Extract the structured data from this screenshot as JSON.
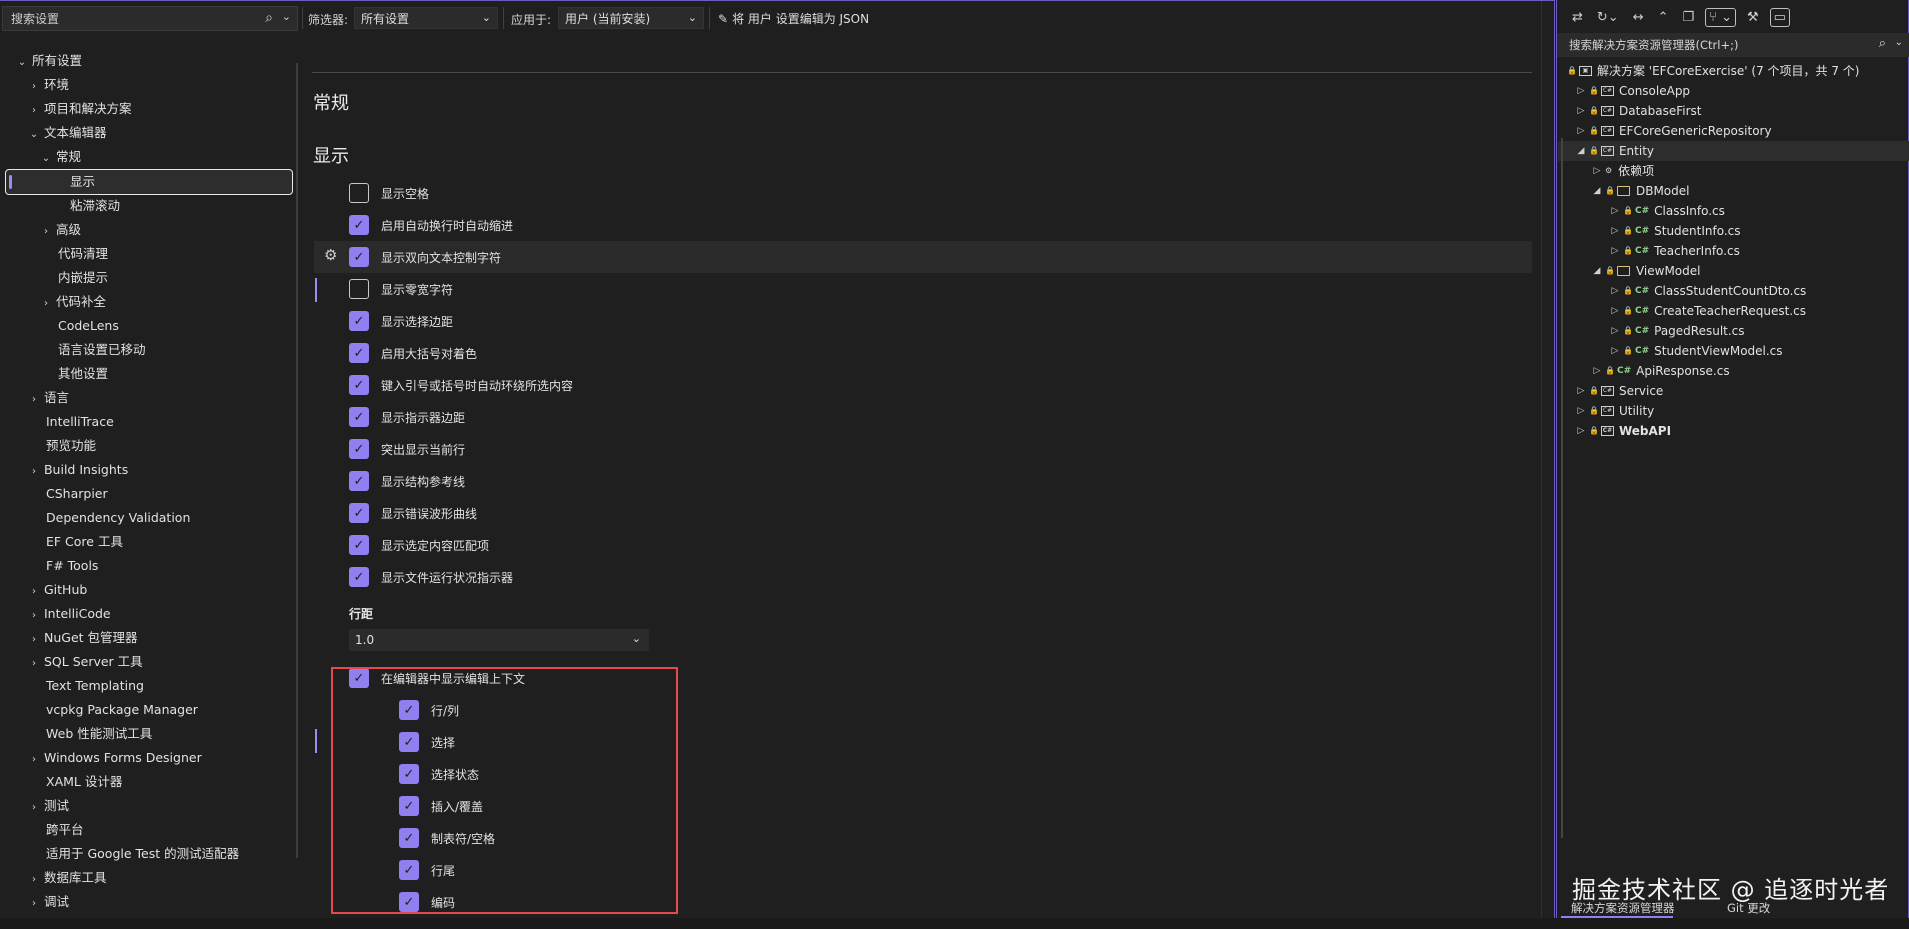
{
  "topbar": {
    "search_placeholder": "搜索设置",
    "filter_label": "筛选器:",
    "filter_value": "所有设置",
    "apply_label": "应用于:",
    "apply_value": "用户 (当前安装)",
    "json_button": "将 用户 设置编辑为 JSON"
  },
  "tree": {
    "items": [
      {
        "label": "所有设置"
      },
      {
        "label": "环境"
      },
      {
        "label": "项目和解决方案"
      },
      {
        "label": "文本编辑器"
      },
      {
        "label": "常规"
      },
      {
        "label": "显示"
      },
      {
        "label": "粘滞滚动"
      },
      {
        "label": "高级"
      },
      {
        "label": "代码清理"
      },
      {
        "label": "内嵌提示"
      },
      {
        "label": "代码补全"
      },
      {
        "label": "CodeLens"
      },
      {
        "label": "语言设置已移动"
      },
      {
        "label": "其他设置"
      },
      {
        "label": "语言"
      },
      {
        "label": "IntelliTrace"
      },
      {
        "label": "预览功能"
      },
      {
        "label": "Build Insights"
      },
      {
        "label": "CSharpier"
      },
      {
        "label": "Dependency Validation"
      },
      {
        "label": "EF Core 工具"
      },
      {
        "label": "F# Tools"
      },
      {
        "label": "GitHub"
      },
      {
        "label": "IntelliCode"
      },
      {
        "label": "NuGet 包管理器"
      },
      {
        "label": "SQL Server 工具"
      },
      {
        "label": "Text Templating"
      },
      {
        "label": "vcpkg Package Manager"
      },
      {
        "label": "Web 性能测试工具"
      },
      {
        "label": "Windows Forms Designer"
      },
      {
        "label": "XAML 设计器"
      },
      {
        "label": "测试"
      },
      {
        "label": "跨平台"
      },
      {
        "label": "适用于 Google Test 的测试适配器"
      },
      {
        "label": "数据库工具"
      },
      {
        "label": "调试"
      }
    ]
  },
  "content": {
    "section_title": "常规",
    "subsection_title": "显示",
    "options": [
      {
        "label": "显示空格",
        "checked": false
      },
      {
        "label": "启用自动换行时自动缩进",
        "checked": true
      },
      {
        "label": "显示双向文本控制字符",
        "checked": true
      },
      {
        "label": "显示零宽字符",
        "checked": false
      },
      {
        "label": "显示选择边距",
        "checked": true
      },
      {
        "label": "启用大括号对着色",
        "checked": true
      },
      {
        "label": "键入引号或括号时自动环绕所选内容",
        "checked": true
      },
      {
        "label": "显示指示器边距",
        "checked": true
      },
      {
        "label": "突出显示当前行",
        "checked": true
      },
      {
        "label": "显示结构参考线",
        "checked": true
      },
      {
        "label": "显示错误波形曲线",
        "checked": true
      },
      {
        "label": "显示选定内容匹配项",
        "checked": true
      },
      {
        "label": "显示文件运行状况指示器",
        "checked": true
      }
    ],
    "line_spacing_label": "行距",
    "line_spacing_value": "1.0",
    "context_option": {
      "label": "在编辑器中显示编辑上下文",
      "checked": true
    },
    "context_suboptions": [
      {
        "label": "行/列",
        "checked": true
      },
      {
        "label": "选择",
        "checked": true
      },
      {
        "label": "选择状态",
        "checked": true
      },
      {
        "label": "插入/覆盖",
        "checked": true
      },
      {
        "label": "制表符/空格",
        "checked": true
      },
      {
        "label": "行尾",
        "checked": true
      },
      {
        "label": "编码",
        "checked": true
      }
    ]
  },
  "solution_explorer": {
    "search_placeholder": "搜索解决方案资源管理器(Ctrl+;)",
    "nodes": [
      {
        "label": "解决方案 'EFCoreExercise' (7 个项目，共 7 个)"
      },
      {
        "label": "ConsoleApp"
      },
      {
        "label": "DatabaseFirst"
      },
      {
        "label": "EFCoreGenericRepository"
      },
      {
        "label": "Entity"
      },
      {
        "label": "依赖项"
      },
      {
        "label": "DBModel"
      },
      {
        "label": "ClassInfo.cs"
      },
      {
        "label": "StudentInfo.cs"
      },
      {
        "label": "TeacherInfo.cs"
      },
      {
        "label": "ViewModel"
      },
      {
        "label": "ClassStudentCountDto.cs"
      },
      {
        "label": "CreateTeacherRequest.cs"
      },
      {
        "label": "PagedResult.cs"
      },
      {
        "label": "StudentViewModel.cs"
      },
      {
        "label": "ApiResponse.cs"
      },
      {
        "label": "Service"
      },
      {
        "label": "Utility"
      },
      {
        "label": "WebAPI"
      }
    ],
    "tab_explorer": "解决方案资源管理器",
    "tab_git": "Git 更改",
    "watermark": "掘金技术社区 @ 追逐时光者"
  },
  "colors": {
    "accent": "#8f7ff0",
    "highlight_box": "#e5484d",
    "background": "#1f1f1f"
  }
}
